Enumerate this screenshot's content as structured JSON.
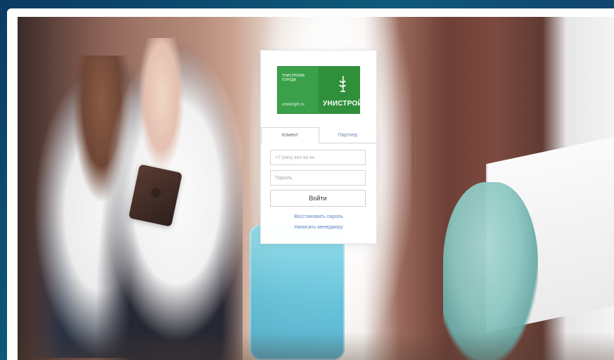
{
  "colors": {
    "background_dark": "#0b3a63",
    "card_bg": "#ffffff",
    "brand_green": "#3aa14a",
    "brand_green_dark": "#2f8f3a",
    "link_blue": "#5e86c2"
  },
  "logo": {
    "left_text_line1": "УНИСТРОИМ",
    "left_text_line2": "ГОРОДА",
    "site": "unistroyrf.ru",
    "brand": "УНИСТРОЙ",
    "mark_icon": "city-tower-icon"
  },
  "tabs": [
    {
      "label": "Клиент",
      "active": true
    },
    {
      "label": "Партнер",
      "active": false
    }
  ],
  "form": {
    "phone_placeholder": "+7 (xxx) xxx-xx-xx",
    "password_placeholder": "Пароль",
    "submit_label": "Войти"
  },
  "links": {
    "restore_password": "Восстановить пароль",
    "write_manager": "Написать менеджеру"
  }
}
